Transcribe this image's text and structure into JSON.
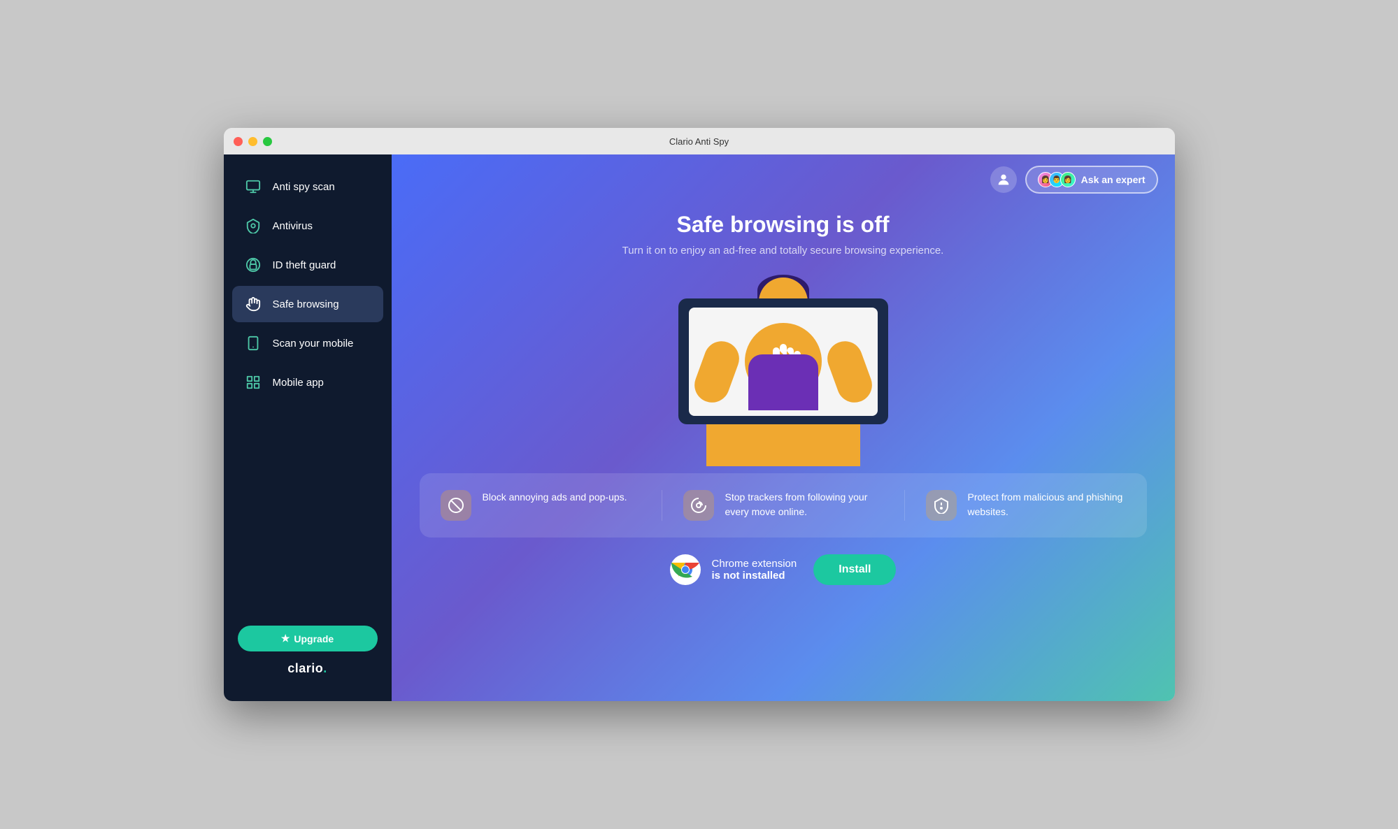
{
  "window": {
    "title": "Clario Anti Spy"
  },
  "sidebar": {
    "nav_items": [
      {
        "id": "anti-spy-scan",
        "label": "Anti spy scan",
        "icon": "monitor"
      },
      {
        "id": "antivirus",
        "label": "Antivirus",
        "icon": "shield"
      },
      {
        "id": "id-theft-guard",
        "label": "ID theft guard",
        "icon": "lock-circle"
      },
      {
        "id": "safe-browsing",
        "label": "Safe browsing",
        "icon": "hand",
        "active": true
      },
      {
        "id": "scan-mobile",
        "label": "Scan your mobile",
        "icon": "mobile"
      },
      {
        "id": "mobile-app",
        "label": "Mobile app",
        "icon": "grid"
      }
    ],
    "upgrade_label": "Upgrade",
    "logo_text": "clario",
    "logo_dot": "."
  },
  "header": {
    "ask_expert_label": "Ask an expert"
  },
  "hero": {
    "title": "Safe browsing is off",
    "subtitle": "Turn it on to enjoy an ad-free and totally secure browsing experience."
  },
  "features": [
    {
      "icon": "ad-block",
      "text": "Block annoying ads and pop-ups."
    },
    {
      "icon": "tracker",
      "text": "Stop trackers from following your every move online."
    },
    {
      "icon": "phishing",
      "text": "Protect from malicious and phishing websites."
    }
  ],
  "chrome_extension": {
    "label_line1": "Chrome extension",
    "label_line2": "is not installed",
    "install_label": "Install"
  }
}
